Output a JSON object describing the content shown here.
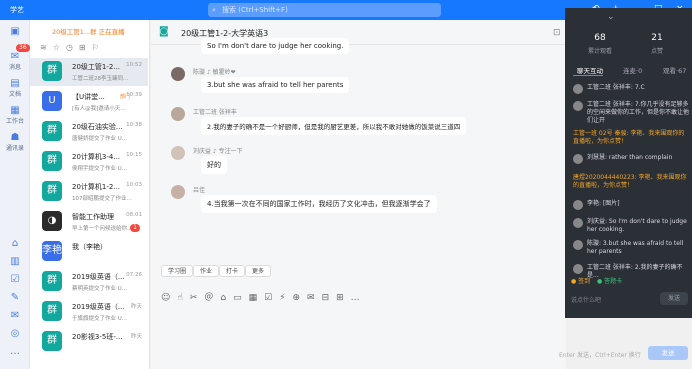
{
  "app": {
    "name": "学艺"
  },
  "search": {
    "placeholder": "搜索 (Ctrl+Shift+F)"
  },
  "rail": {
    "badge": "36",
    "items": [
      "消息",
      "文档",
      "工作台",
      "通讯录"
    ]
  },
  "conv": {
    "ticker": "20级工管1...群 正在直播",
    "items": [
      {
        "name": "20级工管1-2...",
        "preview": "工管二班28李玉臻同...",
        "time": "10:52",
        "avatar": "群",
        "selected": true
      },
      {
        "name": "【U讲堂...",
        "preview": "[有人@我]邀请小天...",
        "time": "10:39",
        "avatar": "U",
        "tag": "部门"
      },
      {
        "name": "20级石油实验...",
        "preview": "唐健娇提交了作业 U...",
        "time": "10:38",
        "avatar": "群"
      },
      {
        "name": "20计算机3-4...",
        "preview": "侯翔宇提交了作业 U...",
        "time": "10:15",
        "avatar": "群"
      },
      {
        "name": "20计算机1-2...",
        "preview": "107部昭鹏提交了作业...",
        "time": "10:03",
        "avatar": "群"
      },
      {
        "name": "智能工作助理",
        "preview": "早上第一个问候送给你...",
        "time": "08:01",
        "avatar": "◑",
        "badge": "1"
      },
      {
        "name": "我（李艳）",
        "preview": "",
        "time": "",
        "avatar": "李艳"
      },
      {
        "name": "2019级英语（...",
        "preview": "蔡明英提交了作业 U...",
        "time": "07:26",
        "avatar": "群"
      },
      {
        "name": "2019级英语（...",
        "preview": "于旗旗提交了作业 U...",
        "time": "昨天",
        "avatar": "群"
      },
      {
        "name": "20影视3-5班-...",
        "preview": "",
        "time": "昨天",
        "avatar": "群"
      }
    ]
  },
  "chat": {
    "title": "20级工管1-2-大学英语3",
    "messages": [
      {
        "who": "",
        "text": "So I'm don't dare to judge her cooking."
      },
      {
        "who": "陈璇  ♪ 敏霍岭❤",
        "text": "3.but she was afraid to tell her parents"
      },
      {
        "who": "工管二班 张祥丰",
        "text": "2.我的妻子的确不是一个好厨师，但是我的厨艺更差，所以我不敢对她做的饭菜说三道四"
      },
      {
        "who": "刘庆益  ♪ 专注一下",
        "text": "好的"
      },
      {
        "who": "吕佳",
        "text": "4.当我第一次在不同的国家工作时，我经历了文化冲击，但我逐渐学会了"
      }
    ],
    "quick": [
      "学习圈",
      "作业",
      "打卡",
      "更多"
    ],
    "send_hint": "Enter 发送，Ctrl+Enter 换行",
    "send": "发送"
  },
  "live": {
    "stats": [
      {
        "v": "68",
        "l": "累计观看"
      },
      {
        "v": "21",
        "l": "点赞"
      }
    ],
    "tabs": [
      "聊天互动",
      "连麦·0",
      "观看·67"
    ],
    "msgs": [
      {
        "t": "工管二班 张祥丰: 7.C",
        "sys": false
      },
      {
        "t": "工管二班 张祥丰: 7.你几乎没有足够多的空闲来做你的工作，但是你不敢让他们让开",
        "sys": false
      },
      {
        "t": "工管一班 02号 秦骏: 李艳、我来围观你的直播啦，为你点赞！",
        "sys": true
      },
      {
        "t": "刘慧慧: rather than complain",
        "sys": false
      },
      {
        "t": "唐煜2020044440223: 李艳、我来围观你的直播啦，为你点赞！",
        "sys": true
      },
      {
        "t": "李艳: [图片]",
        "sys": false
      },
      {
        "t": "刘庆益: So I'm don't dare to judge her cooking.",
        "sys": false
      },
      {
        "t": "陈璇: 3.but she was afraid to tell her parents",
        "sys": false
      },
      {
        "t": "工管二班 张祥丰: 2.我的妻子的确不是...",
        "sys": false
      }
    ],
    "actions": [
      "签到",
      "答题卡"
    ],
    "input": "说点什么吧",
    "send": "发送"
  }
}
